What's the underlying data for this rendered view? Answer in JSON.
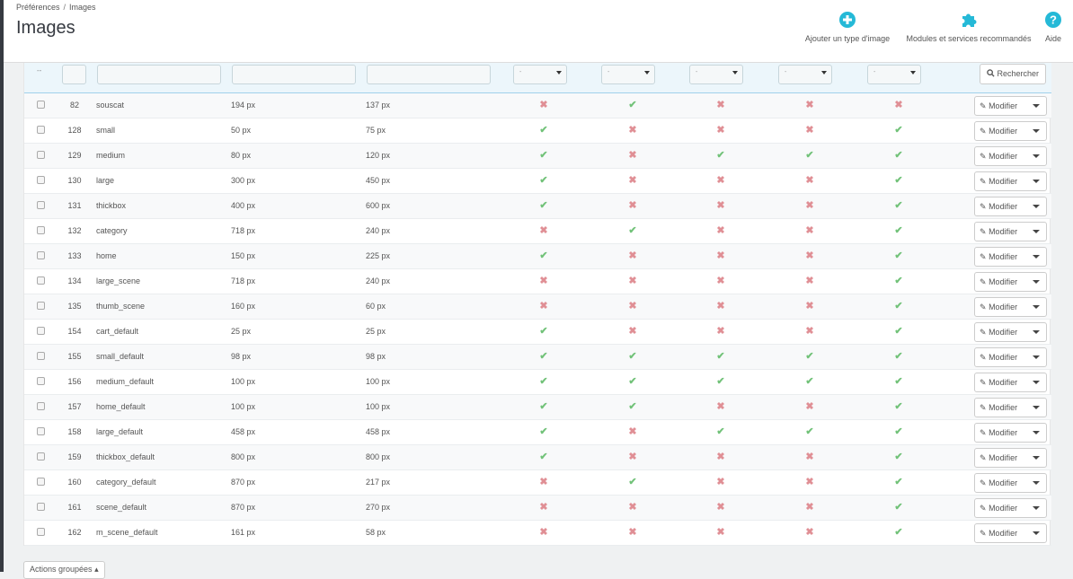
{
  "breadcrumb": {
    "parent": "Préférences",
    "separator": "/",
    "current": "Images"
  },
  "page_title": "Images",
  "toolbar": {
    "add_label": "Ajouter un type d'image",
    "modules_label": "Modules et services recommandés",
    "help_label": "Aide",
    "accent": "#25b9d7"
  },
  "filters": {
    "select_placeholder": "-",
    "search_label": "Rechercher",
    "check_placeholder": "--"
  },
  "row_action_label": "Modifier",
  "bulk_label": "Actions groupées",
  "status_colors": {
    "yes": "#72c279",
    "no": "#e08f95"
  },
  "rows": [
    {
      "id": "82",
      "name": "souscat",
      "width": "194 px",
      "height": "137 px",
      "flags": [
        false,
        true,
        false,
        false,
        false
      ]
    },
    {
      "id": "128",
      "name": "small",
      "width": "50 px",
      "height": "75 px",
      "flags": [
        true,
        false,
        false,
        false,
        true
      ]
    },
    {
      "id": "129",
      "name": "medium",
      "width": "80 px",
      "height": "120 px",
      "flags": [
        true,
        false,
        true,
        true,
        true
      ]
    },
    {
      "id": "130",
      "name": "large",
      "width": "300 px",
      "height": "450 px",
      "flags": [
        true,
        false,
        false,
        false,
        true
      ]
    },
    {
      "id": "131",
      "name": "thickbox",
      "width": "400 px",
      "height": "600 px",
      "flags": [
        true,
        false,
        false,
        false,
        true
      ]
    },
    {
      "id": "132",
      "name": "category",
      "width": "718 px",
      "height": "240 px",
      "flags": [
        false,
        true,
        false,
        false,
        true
      ]
    },
    {
      "id": "133",
      "name": "home",
      "width": "150 px",
      "height": "225 px",
      "flags": [
        true,
        false,
        false,
        false,
        true
      ]
    },
    {
      "id": "134",
      "name": "large_scene",
      "width": "718 px",
      "height": "240 px",
      "flags": [
        false,
        false,
        false,
        false,
        true
      ]
    },
    {
      "id": "135",
      "name": "thumb_scene",
      "width": "160 px",
      "height": "60 px",
      "flags": [
        false,
        false,
        false,
        false,
        true
      ]
    },
    {
      "id": "154",
      "name": "cart_default",
      "width": "25 px",
      "height": "25 px",
      "flags": [
        true,
        false,
        false,
        false,
        true
      ]
    },
    {
      "id": "155",
      "name": "small_default",
      "width": "98 px",
      "height": "98 px",
      "flags": [
        true,
        true,
        true,
        true,
        true
      ]
    },
    {
      "id": "156",
      "name": "medium_default",
      "width": "100 px",
      "height": "100 px",
      "flags": [
        true,
        true,
        true,
        true,
        true
      ]
    },
    {
      "id": "157",
      "name": "home_default",
      "width": "100 px",
      "height": "100 px",
      "flags": [
        true,
        true,
        false,
        false,
        true
      ]
    },
    {
      "id": "158",
      "name": "large_default",
      "width": "458 px",
      "height": "458 px",
      "flags": [
        true,
        false,
        true,
        true,
        true
      ]
    },
    {
      "id": "159",
      "name": "thickbox_default",
      "width": "800 px",
      "height": "800 px",
      "flags": [
        true,
        false,
        false,
        false,
        true
      ]
    },
    {
      "id": "160",
      "name": "category_default",
      "width": "870 px",
      "height": "217 px",
      "flags": [
        false,
        true,
        false,
        false,
        true
      ]
    },
    {
      "id": "161",
      "name": "scene_default",
      "width": "870 px",
      "height": "270 px",
      "flags": [
        false,
        false,
        false,
        false,
        true
      ]
    },
    {
      "id": "162",
      "name": "m_scene_default",
      "width": "161 px",
      "height": "58 px",
      "flags": [
        false,
        false,
        false,
        false,
        true
      ]
    }
  ]
}
